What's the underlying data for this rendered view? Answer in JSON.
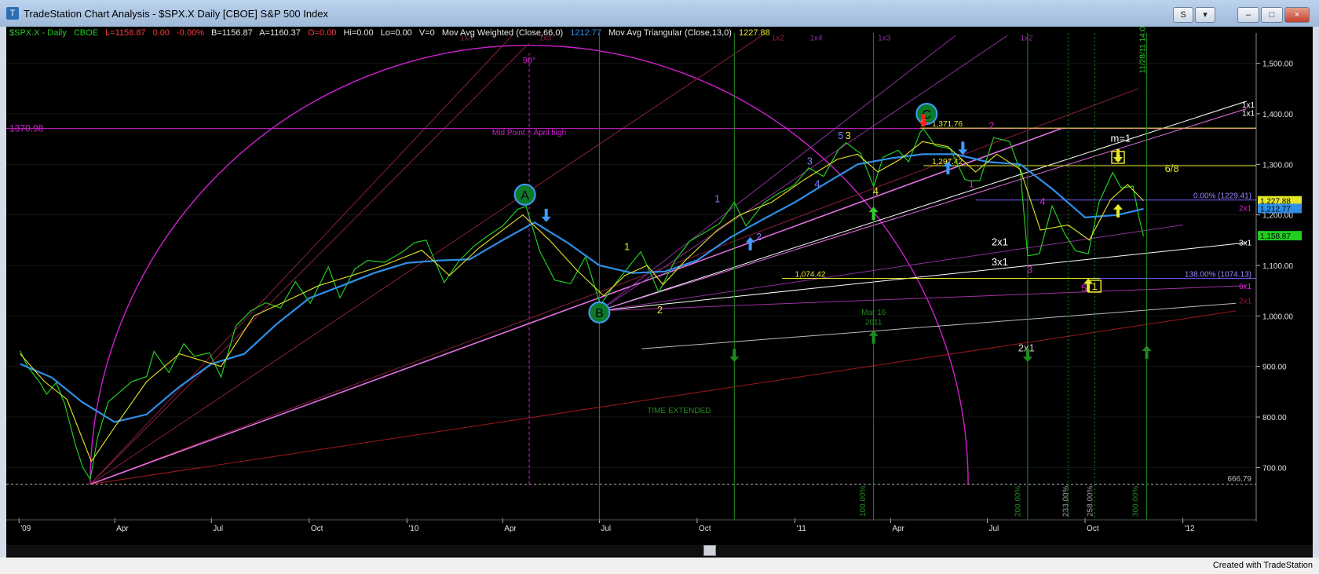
{
  "window": {
    "title": "TradeStation Chart Analysis - $SPX.X Daily [CBOE] S&P 500 Index",
    "buttons": {
      "s": "S",
      "minimize": "–",
      "restore": "□",
      "close": "×"
    }
  },
  "status": {
    "credit": "Created with TradeStation"
  },
  "header": {
    "symbol": "$SPX.X - Daily",
    "exchange": "CBOE",
    "last": "L=1158.87",
    "change": "0.00",
    "pct": "-0.00%",
    "bid": "B=1156.87",
    "ask": "A=1160.37",
    "open": "O=0.00",
    "hi": "Hi=0.00",
    "lo": "Lo=0.00",
    "vol": "V=0",
    "ma1_name": "Mov Avg Weighted (Close,66,0)",
    "ma1_val": "1212.77",
    "ma2_name": "Mov Avg Triangular (Close,13,0)",
    "ma2_val": "1227.88"
  },
  "colors": {
    "price": "#22cc22",
    "ma_weighted": "#2f8fe6",
    "ma_triangular": "#e6e62a",
    "magenta": "#d020d0",
    "fib_line": "#e6e62a",
    "background": "#000000"
  },
  "chart_data": {
    "type": "line",
    "symbol": "$SPX.X",
    "x_ticks": [
      "'09",
      "Apr",
      "Jul",
      "Oct",
      "'10",
      "Apr",
      "Jul",
      "Oct",
      "'11",
      "Apr",
      "Jul",
      "Oct",
      "'12"
    ],
    "y_ticks": [
      "1,500.00",
      "1,400.00",
      "1,300.00",
      "1,200.00",
      "1,100.00",
      "1,000.00",
      "900.00",
      "800.00",
      "700.00"
    ],
    "ylim": [
      640,
      1560
    ],
    "series": [
      {
        "name": "$SPX.X - Daily",
        "points": [
          [
            "2009-01-02",
            931
          ],
          [
            "2009-01-09",
            900
          ],
          [
            "2009-01-20",
            870
          ],
          [
            "2009-01-27",
            845
          ],
          [
            "2009-02-05",
            868
          ],
          [
            "2009-02-13",
            826
          ],
          [
            "2009-02-23",
            745
          ],
          [
            "2009-03-02",
            700
          ],
          [
            "2009-03-09",
            677
          ],
          [
            "2009-03-16",
            760
          ],
          [
            "2009-03-26",
            830
          ],
          [
            "2009-04-06",
            850
          ],
          [
            "2009-04-17",
            870
          ],
          [
            "2009-05-01",
            880
          ],
          [
            "2009-05-08",
            930
          ],
          [
            "2009-05-22",
            888
          ],
          [
            "2009-06-05",
            945
          ],
          [
            "2009-06-15",
            920
          ],
          [
            "2009-06-29",
            927
          ],
          [
            "2009-07-10",
            879
          ],
          [
            "2009-07-24",
            980
          ],
          [
            "2009-08-07",
            1010
          ],
          [
            "2009-08-21",
            1026
          ],
          [
            "2009-09-04",
            1016
          ],
          [
            "2009-09-18",
            1068
          ],
          [
            "2009-10-02",
            1025
          ],
          [
            "2009-10-19",
            1097
          ],
          [
            "2009-10-30",
            1036
          ],
          [
            "2009-11-13",
            1093
          ],
          [
            "2009-11-25",
            1110
          ],
          [
            "2009-12-11",
            1106
          ],
          [
            "2009-12-28",
            1127
          ],
          [
            "2010-01-08",
            1145
          ],
          [
            "2010-01-19",
            1150
          ],
          [
            "2010-02-05",
            1066
          ],
          [
            "2010-02-19",
            1109
          ],
          [
            "2010-03-05",
            1138
          ],
          [
            "2010-03-19",
            1160
          ],
          [
            "2010-04-01",
            1178
          ],
          [
            "2010-04-15",
            1211
          ],
          [
            "2010-04-23",
            1217
          ],
          [
            "2010-05-06",
            1128
          ],
          [
            "2010-05-20",
            1071
          ],
          [
            "2010-06-04",
            1064
          ],
          [
            "2010-06-18",
            1117
          ],
          [
            "2010-07-02",
            1022
          ],
          [
            "2010-07-16",
            1064
          ],
          [
            "2010-07-30",
            1101
          ],
          [
            "2010-08-09",
            1127
          ],
          [
            "2010-08-26",
            1047
          ],
          [
            "2010-09-10",
            1109
          ],
          [
            "2010-09-24",
            1148
          ],
          [
            "2010-10-08",
            1165
          ],
          [
            "2010-10-22",
            1183
          ],
          [
            "2010-11-05",
            1225
          ],
          [
            "2010-11-16",
            1178
          ],
          [
            "2010-12-03",
            1224
          ],
          [
            "2010-12-17",
            1243
          ],
          [
            "2010-12-31",
            1258
          ],
          [
            "2011-01-14",
            1293
          ],
          [
            "2011-01-28",
            1276
          ],
          [
            "2011-02-11",
            1329
          ],
          [
            "2011-02-18",
            1343
          ],
          [
            "2011-03-04",
            1321
          ],
          [
            "2011-03-16",
            1256
          ],
          [
            "2011-03-25",
            1314
          ],
          [
            "2011-04-08",
            1328
          ],
          [
            "2011-04-18",
            1305
          ],
          [
            "2011-04-29",
            1364
          ],
          [
            "2011-05-02",
            1370
          ],
          [
            "2011-05-13",
            1337
          ],
          [
            "2011-05-27",
            1331
          ],
          [
            "2011-06-10",
            1270
          ],
          [
            "2011-06-16",
            1267
          ],
          [
            "2011-06-24",
            1268
          ],
          [
            "2011-07-07",
            1353
          ],
          [
            "2011-07-22",
            1345
          ],
          [
            "2011-08-01",
            1287
          ],
          [
            "2011-08-08",
            1119
          ],
          [
            "2011-08-19",
            1123
          ],
          [
            "2011-08-31",
            1218
          ],
          [
            "2011-09-12",
            1162
          ],
          [
            "2011-09-22",
            1129
          ],
          [
            "2011-10-04",
            1123
          ],
          [
            "2011-10-14",
            1224
          ],
          [
            "2011-10-27",
            1284
          ],
          [
            "2011-11-04",
            1253
          ],
          [
            "2011-11-15",
            1257
          ],
          [
            "2011-11-21",
            1192
          ],
          [
            "2011-11-25",
            1158
          ]
        ]
      },
      {
        "name": "Mov Avg Weighted (Close,66,0)",
        "points": [
          [
            "2009-01-02",
            905
          ],
          [
            "2009-02-01",
            878
          ],
          [
            "2009-03-01",
            830
          ],
          [
            "2009-04-01",
            790
          ],
          [
            "2009-05-01",
            805
          ],
          [
            "2009-06-01",
            860
          ],
          [
            "2009-07-01",
            905
          ],
          [
            "2009-08-01",
            925
          ],
          [
            "2009-09-01",
            985
          ],
          [
            "2009-10-01",
            1035
          ],
          [
            "2009-11-01",
            1060
          ],
          [
            "2009-12-01",
            1085
          ],
          [
            "2010-01-01",
            1105
          ],
          [
            "2010-02-01",
            1110
          ],
          [
            "2010-03-01",
            1112
          ],
          [
            "2010-04-01",
            1150
          ],
          [
            "2010-05-01",
            1185
          ],
          [
            "2010-06-01",
            1145
          ],
          [
            "2010-07-01",
            1100
          ],
          [
            "2010-08-01",
            1085
          ],
          [
            "2010-09-01",
            1088
          ],
          [
            "2010-10-01",
            1110
          ],
          [
            "2010-11-01",
            1155
          ],
          [
            "2010-12-01",
            1190
          ],
          [
            "2011-01-01",
            1225
          ],
          [
            "2011-02-01",
            1265
          ],
          [
            "2011-03-01",
            1300
          ],
          [
            "2011-04-01",
            1312
          ],
          [
            "2011-05-01",
            1320
          ],
          [
            "2011-06-01",
            1320
          ],
          [
            "2011-07-01",
            1305
          ],
          [
            "2011-08-01",
            1300
          ],
          [
            "2011-09-01",
            1250
          ],
          [
            "2011-10-01",
            1195
          ],
          [
            "2011-11-01",
            1200
          ],
          [
            "2011-11-25",
            1212
          ]
        ]
      },
      {
        "name": "Mov Avg Triangular (Close,13,0)",
        "points": [
          [
            "2009-01-02",
            925
          ],
          [
            "2009-01-25",
            870
          ],
          [
            "2009-02-15",
            835
          ],
          [
            "2009-03-10",
            712
          ],
          [
            "2009-04-01",
            780
          ],
          [
            "2009-05-01",
            870
          ],
          [
            "2009-06-01",
            925
          ],
          [
            "2009-07-10",
            900
          ],
          [
            "2009-08-10",
            1000
          ],
          [
            "2009-09-10",
            1030
          ],
          [
            "2009-10-10",
            1060
          ],
          [
            "2009-11-10",
            1080
          ],
          [
            "2009-12-10",
            1100
          ],
          [
            "2010-01-15",
            1130
          ],
          [
            "2010-02-10",
            1080
          ],
          [
            "2010-03-10",
            1135
          ],
          [
            "2010-04-20",
            1200
          ],
          [
            "2010-05-15",
            1150
          ],
          [
            "2010-06-10",
            1090
          ],
          [
            "2010-07-05",
            1040
          ],
          [
            "2010-07-25",
            1080
          ],
          [
            "2010-08-15",
            1100
          ],
          [
            "2010-08-30",
            1062
          ],
          [
            "2010-09-20",
            1110
          ],
          [
            "2010-10-20",
            1170
          ],
          [
            "2010-11-10",
            1200
          ],
          [
            "2010-12-10",
            1225
          ],
          [
            "2011-01-10",
            1270
          ],
          [
            "2011-02-10",
            1310
          ],
          [
            "2011-03-01",
            1320
          ],
          [
            "2011-03-20",
            1285
          ],
          [
            "2011-04-10",
            1310
          ],
          [
            "2011-05-01",
            1345
          ],
          [
            "2011-05-25",
            1335
          ],
          [
            "2011-06-20",
            1285
          ],
          [
            "2011-07-10",
            1320
          ],
          [
            "2011-08-01",
            1290
          ],
          [
            "2011-08-20",
            1170
          ],
          [
            "2011-09-15",
            1180
          ],
          [
            "2011-10-05",
            1150
          ],
          [
            "2011-10-25",
            1230
          ],
          [
            "2011-11-10",
            1260
          ],
          [
            "2011-11-25",
            1228
          ]
        ]
      }
    ],
    "price_labels": [
      {
        "text": "1,227.88",
        "value": 1227.88,
        "color": "#e6e62a"
      },
      {
        "text": "1,212.77",
        "value": 1212.77,
        "color": "#2f8fe6"
      },
      {
        "text": "1,158.87",
        "value": 1158.87,
        "color": "#22cc22"
      }
    ],
    "horizontal_lines": [
      {
        "label": "1370.98",
        "value": 1370.98,
        "color": "#d020d0"
      },
      {
        "label": "1,371.76",
        "value": 1371.76,
        "color": "#e6e62a"
      },
      {
        "label": "1,297.42",
        "value": 1297.42,
        "color": "#e6e62a"
      },
      {
        "label": "0.00% (1229.41)",
        "value": 1229.41,
        "color": "#7a5cff"
      },
      {
        "label": "1,074.42",
        "value": 1074.42,
        "color": "#e6e62a"
      },
      {
        "label": "138.00% (1074.13)",
        "value": 1074.13,
        "color": "#7a5cff"
      },
      {
        "label": "666.79",
        "value": 666.79,
        "color": "#bbbbbb"
      }
    ],
    "wave_labels": [
      {
        "text": "A",
        "x": "2010-04-22",
        "y": 1240,
        "style": "circle"
      },
      {
        "text": "B",
        "x": "2010-07-01",
        "y": 1007,
        "style": "circle"
      },
      {
        "text": "C",
        "x": "2011-05-05",
        "y": 1400,
        "style": "circle"
      },
      {
        "text": "1",
        "x": "2010-07-27",
        "y": 1130,
        "color": "#e6e62a"
      },
      {
        "text": "2",
        "x": "2010-08-27",
        "y": 1005,
        "color": "#e6e62a"
      },
      {
        "text": "3",
        "x": "2011-02-20",
        "y": 1350,
        "color": "#e6e62a"
      },
      {
        "text": "4",
        "x": "2011-03-18",
        "y": 1240,
        "color": "#e6e62a"
      },
      {
        "text": "5",
        "x": "2011-05-02",
        "y": 1375,
        "color": "#e6e62a"
      },
      {
        "text": "2",
        "x": "2011-07-05",
        "y": 1370,
        "color": "#d020d0"
      },
      {
        "text": "3",
        "x": "2011-08-10",
        "y": 1085,
        "color": "#d020d0"
      },
      {
        "text": "4",
        "x": "2011-08-22",
        "y": 1220,
        "color": "#d020d0"
      },
      {
        "text": "5",
        "x": "2011-09-30",
        "y": 1048,
        "color": "#d020d0"
      },
      {
        "text": "1",
        "x": "2011-06-16",
        "y": 1255,
        "color": "#d020d0"
      },
      {
        "text": "1",
        "x": "2010-10-20",
        "y": 1225,
        "color": "#7a7aff"
      },
      {
        "text": "2",
        "x": "2010-11-28",
        "y": 1150,
        "color": "#7a7aff"
      },
      {
        "text": "3",
        "x": "2011-01-15",
        "y": 1300,
        "color": "#7a7aff"
      },
      {
        "text": "4",
        "x": "2011-01-22",
        "y": 1255,
        "color": "#7a7aff"
      },
      {
        "text": "5",
        "x": "2011-02-13",
        "y": 1350,
        "color": "#7a7aff"
      },
      {
        "text": "1",
        "x": "2011-10-10",
        "y": 1055,
        "color": "#e6e62a",
        "style": "box"
      },
      {
        "text": "2",
        "x": "2011-11-01",
        "y": 1310,
        "color": "#e6e62a",
        "style": "box"
      }
    ],
    "gann_labels": [
      "1x4",
      "1x3",
      "1x2",
      "1x4",
      "1x3",
      "1x2",
      "1x1",
      "1x1",
      "2x1",
      "2x1",
      "3x1",
      "3x1",
      "2x1",
      "6x1",
      "2x1",
      "m=1",
      "6/8"
    ],
    "annotations": [
      "90°",
      "Mid Point = April high",
      "TIME EXTENDED",
      "Mar 16",
      "2011",
      "11/28/11 14:00"
    ],
    "time_pcts": [
      "100.00%",
      "200.00%",
      "233.00%",
      "258.00%",
      "300.00%"
    ]
  }
}
